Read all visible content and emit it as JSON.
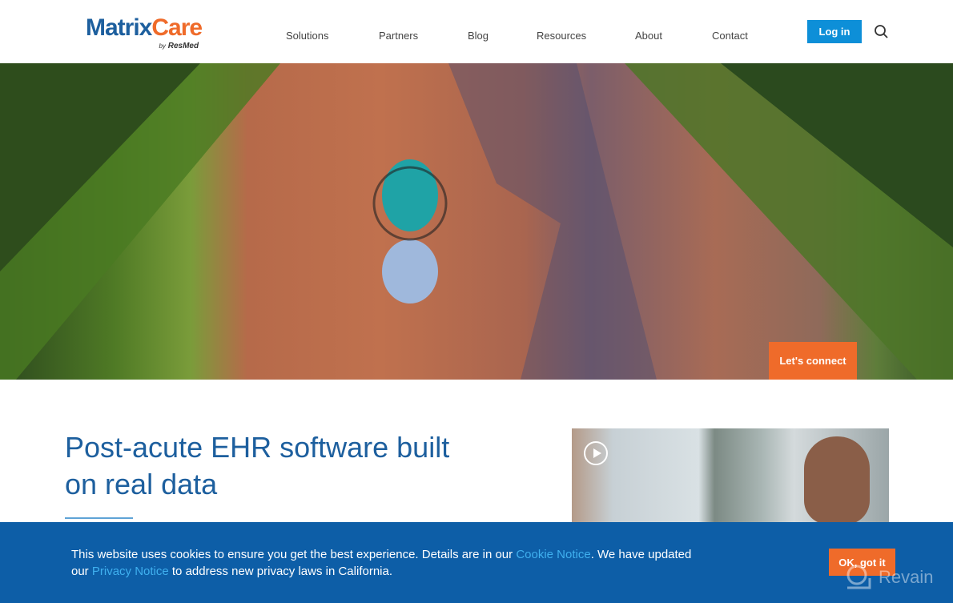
{
  "header": {
    "logo_main": "Matrix",
    "logo_accent": "Care",
    "logo_by": "by",
    "logo_sub": "ResMed",
    "nav": [
      {
        "label": "Solutions"
      },
      {
        "label": "Partners"
      },
      {
        "label": "Blog"
      },
      {
        "label": "Resources"
      },
      {
        "label": "About"
      },
      {
        "label": "Contact"
      }
    ],
    "login_label": "Log in",
    "search_icon": "search-icon"
  },
  "hero": {
    "connect_label": "Let's connect"
  },
  "main": {
    "headline": "Post-acute EHR software built on real data",
    "video_icon": "play-icon"
  },
  "cookie": {
    "text1": "This website uses cookies to ensure you get the best experience. Details are in our ",
    "link1": "Cookie Notice",
    "text2": ". We have updated our ",
    "link2": "Privacy Notice",
    "text3": " to address new privacy laws in California.",
    "ok_label": "OK, got it"
  },
  "watermark": "Revain",
  "colors": {
    "brand_blue": "#1d5f9e",
    "accent_orange": "#ef6b2a",
    "cookie_bg": "#0d5ea7",
    "login_blue": "#0d8fd8"
  }
}
